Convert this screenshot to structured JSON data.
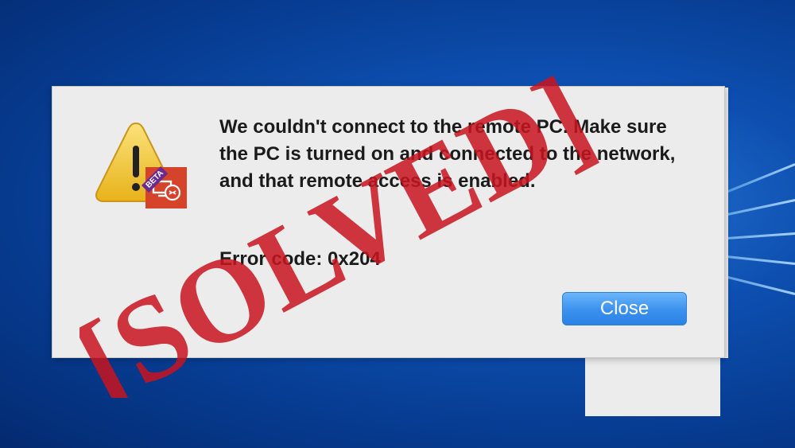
{
  "dialog": {
    "message": "We couldn't connect to the remote PC. Make sure the PC is turned on and connected to the network, and that remote access is enabled.",
    "error_code": "Error code: 0x204",
    "close_label": "Close",
    "icon": "warning-triangle-icon",
    "app_badge_icon": "remote-desktop-icon",
    "beta_label": "BETA"
  },
  "stamp": {
    "text": "[SOLVED]",
    "color": "#c8141e"
  },
  "colors": {
    "desktop_blue": "#0d4fb0",
    "dialog_bg": "#ececec",
    "button_blue": "#3a90ee",
    "warning_yellow": "#f2c42c",
    "badge_orange": "#d4432a",
    "beta_purple": "#6a2a8e"
  }
}
